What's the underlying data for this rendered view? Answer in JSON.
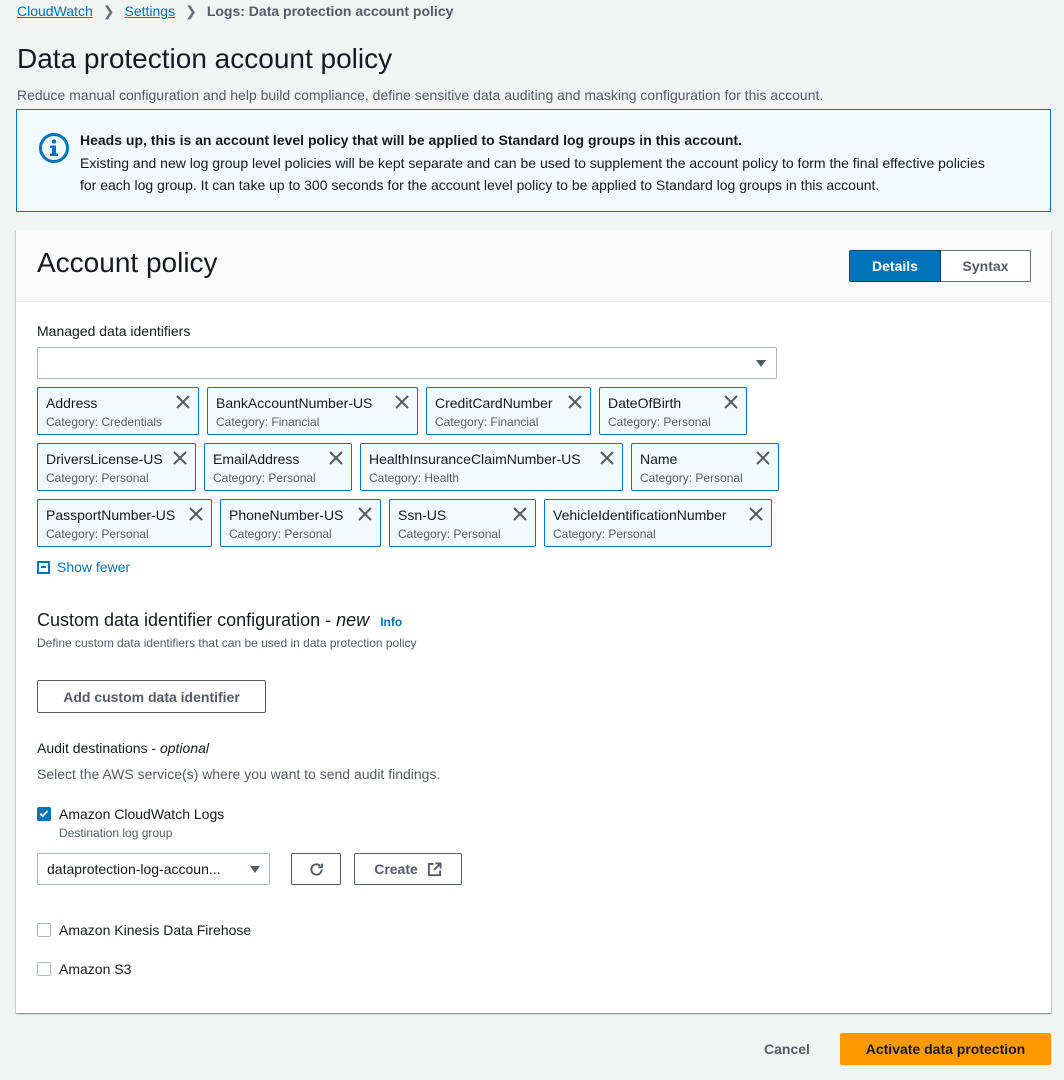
{
  "breadcrumb": {
    "items": [
      {
        "label": "CloudWatch"
      },
      {
        "label": "Settings"
      }
    ],
    "current": "Logs: Data protection account policy"
  },
  "page": {
    "title": "Data protection account policy",
    "description": "Reduce manual configuration and help build compliance, define sensitive data auditing and masking configuration for this account."
  },
  "alert": {
    "icon": "info-icon",
    "title": "Heads up, this is an account level policy that will be applied to Standard log groups in this account.",
    "body": "Existing and new log group level policies will be kept separate and can be used to supplement the account policy to form the final effective policies for each log group. It can take up to 300 seconds for the account level policy to be applied to Standard log groups in this account."
  },
  "panel": {
    "title": "Account policy",
    "tabs": [
      {
        "label": "Details",
        "active": true
      },
      {
        "label": "Syntax",
        "active": false
      }
    ]
  },
  "managed_identifiers": {
    "label": "Managed data identifiers",
    "input_value": "",
    "tokens": [
      {
        "name": "Address",
        "category": "Category: Credentials"
      },
      {
        "name": "BankAccountNumber-US",
        "category": "Category: Financial"
      },
      {
        "name": "CreditCardNumber",
        "category": "Category: Financial"
      },
      {
        "name": "DateOfBirth",
        "category": "Category: Personal"
      },
      {
        "name": "DriversLicense-US",
        "category": "Category: Personal"
      },
      {
        "name": "EmailAddress",
        "category": "Category: Personal"
      },
      {
        "name": "HealthInsuranceClaimNumber-US",
        "category": "Category: Health"
      },
      {
        "name": "Name",
        "category": "Category: Personal"
      },
      {
        "name": "PassportNumber-US",
        "category": "Category: Personal"
      },
      {
        "name": "PhoneNumber-US",
        "category": "Category: Personal"
      },
      {
        "name": "Ssn-US",
        "category": "Category: Personal"
      },
      {
        "name": "VehicleIdentificationNumber",
        "category": "Category: Personal"
      }
    ],
    "show_fewer_label": "Show fewer"
  },
  "custom_identifiers": {
    "title_prefix": "Custom data identifier configuration - ",
    "title_emphasis": "new",
    "info_label": "Info",
    "description": "Define custom data identifiers that can be used in data protection policy",
    "add_button_label": "Add custom data identifier"
  },
  "audit": {
    "title_prefix": "Audit destinations - ",
    "title_emphasis": "optional",
    "description": "Select the AWS service(s) where you want to send audit findings.",
    "destinations": [
      {
        "label": "Amazon CloudWatch Logs",
        "checked": true,
        "sub_label": "Destination log group"
      },
      {
        "label": "Amazon Kinesis Data Firehose",
        "checked": false
      },
      {
        "label": "Amazon S3",
        "checked": false
      }
    ],
    "log_group_value": "dataprotection-log-accoun...",
    "create_label": "Create"
  },
  "footer": {
    "cancel_label": "Cancel",
    "primary_label": "Activate data protection"
  },
  "colors": {
    "link": "#0073bb",
    "primary_button": "#ff9900",
    "alert_bg": "#f1faff"
  }
}
